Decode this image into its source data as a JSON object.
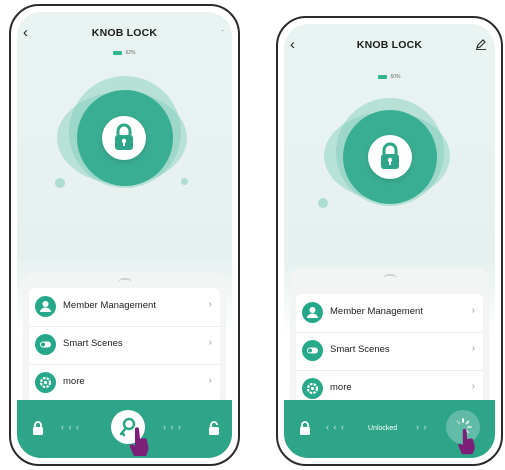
{
  "phone_left": {
    "title": "KNOB LOCK",
    "battery": "62%",
    "menu": [
      {
        "label": "Member Management",
        "icon": "person-icon"
      },
      {
        "label": "Smart Scenes",
        "icon": "toggle-icon"
      },
      {
        "label": "more",
        "icon": "gear-icon"
      }
    ],
    "bar": {
      "left_arrows": "‹ ‹ ‹",
      "right_arrows": "› › ›",
      "state": "knob-key"
    }
  },
  "phone_right": {
    "title": "KNOB LOCK",
    "battery": "60%",
    "menu": [
      {
        "label": "Member Management",
        "icon": "person-icon"
      },
      {
        "label": "Smart Scenes",
        "icon": "toggle-icon"
      },
      {
        "label": "more",
        "icon": "gear-icon"
      }
    ],
    "bar": {
      "left_arrows": "‹ ‹ ‹",
      "right_arrows": "› ›",
      "status": "Unlocked",
      "state": "loading"
    }
  },
  "colors": {
    "accent": "#2ea588",
    "hand": "#7d1f79",
    "background": "#e9f3f1"
  },
  "icons": {
    "back": "back-arrow-icon",
    "edit": "pencil-icon",
    "lock_closed": "lock-icon",
    "lock_open": "unlock-icon"
  }
}
